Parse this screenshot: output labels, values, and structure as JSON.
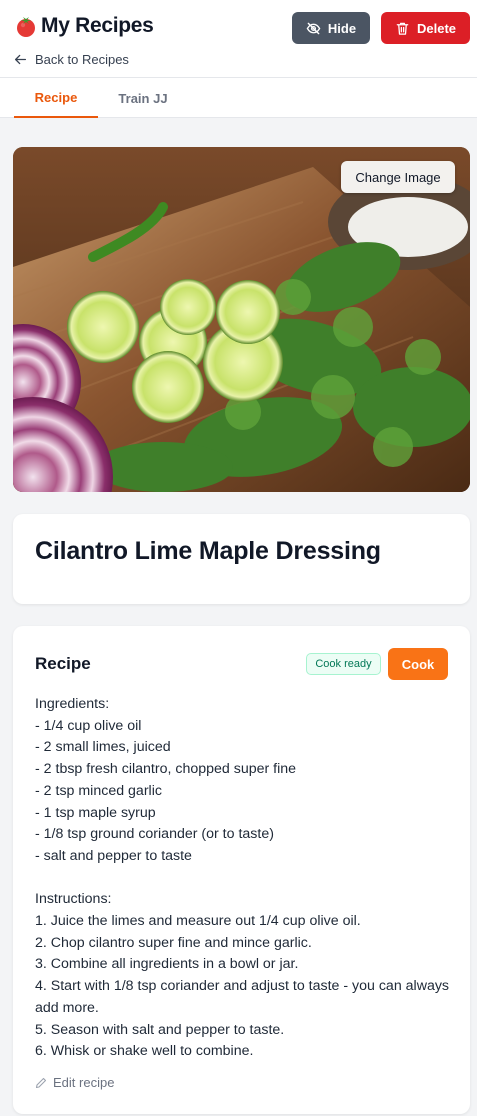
{
  "header": {
    "title": "My Recipes",
    "logo_icon": "tomato-icon",
    "back_label": "Back to Recipes",
    "hide_label": "Hide",
    "delete_label": "Delete"
  },
  "tabs": [
    {
      "label": "Recipe",
      "active": true
    },
    {
      "label": "Train JJ",
      "active": false
    }
  ],
  "image": {
    "change_label": "Change Image"
  },
  "recipe": {
    "title": "Cilantro Lime Maple Dressing",
    "section_heading": "Recipe",
    "status_badge": "Cook ready",
    "cook_label": "Cook",
    "ingredients_heading": "Ingredients:",
    "ingredients": [
      "- 1/4 cup olive oil",
      "- 2 small limes, juiced",
      "- 2 tbsp fresh cilantro, chopped super fine",
      "- 2 tsp minced garlic",
      "- 1 tsp maple syrup",
      "- 1/8 tsp ground coriander (or to taste)",
      "- salt and pepper to taste"
    ],
    "instructions_heading": "Instructions:",
    "instructions": [
      "1. Juice the limes and measure out 1/4 cup olive oil.",
      "2. Chop cilantro super fine and mince garlic.",
      "3. Combine all ingredients in a bowl or jar.",
      "4. Start with 1/8 tsp coriander and adjust to taste - you can always add more.",
      "5. Season with salt and pepper to taste.",
      "6. Whisk or shake well to combine."
    ],
    "edit_label": "Edit recipe"
  },
  "colors": {
    "accent": "#ea580c",
    "cook_button": "#f97316",
    "delete_button": "#dc1f26",
    "hide_button": "#4b5563",
    "badge_text": "#047857"
  }
}
